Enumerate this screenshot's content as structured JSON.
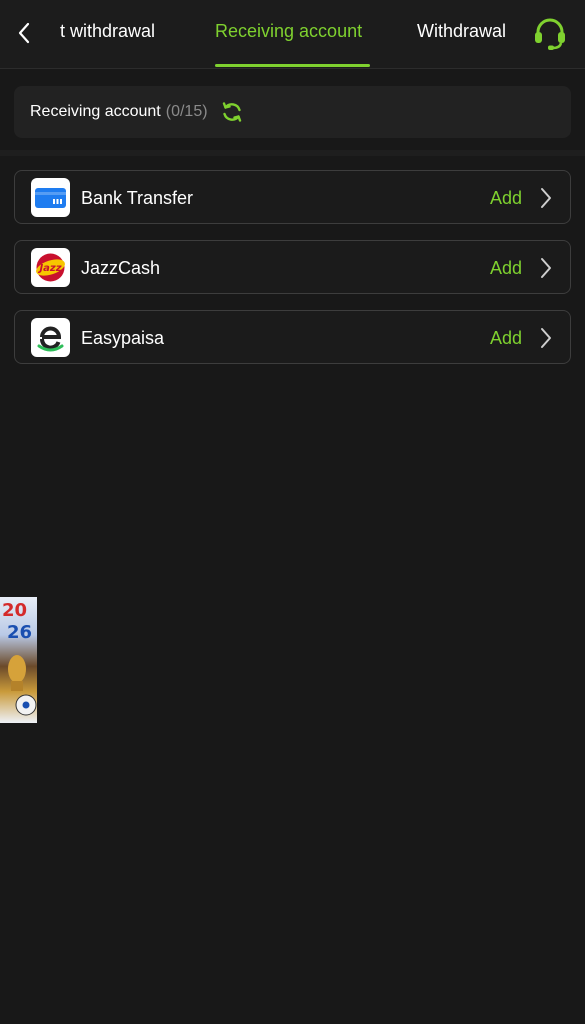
{
  "header": {
    "tabs": [
      {
        "label": "t withdrawal"
      },
      {
        "label": "Receiving account"
      },
      {
        "label": "Withdrawal"
      }
    ],
    "active_tab_index": 1,
    "accent_color": "#7fd12f"
  },
  "summary": {
    "label": "Receiving account",
    "count": "(0/15)"
  },
  "accounts": [
    {
      "name": "Bank Transfer",
      "action": "Add",
      "icon": "bank-card-icon"
    },
    {
      "name": "JazzCash",
      "action": "Add",
      "icon": "jazzcash-logo"
    },
    {
      "name": "Easypaisa",
      "action": "Add",
      "icon": "easypaisa-logo"
    }
  ],
  "banner": {
    "text_top": "20",
    "text_bottom": "26"
  }
}
